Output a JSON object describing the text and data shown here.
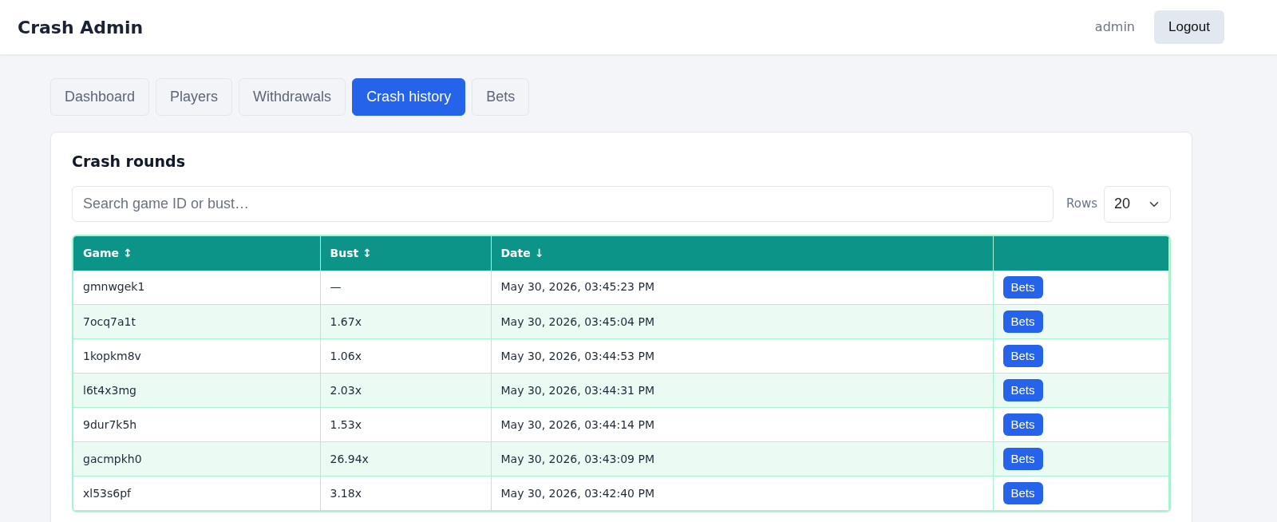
{
  "app": {
    "title": "Crash Admin",
    "user": "admin",
    "logout": "Logout"
  },
  "tabs": [
    {
      "label": "Dashboard",
      "selected": false
    },
    {
      "label": "Players",
      "selected": false
    },
    {
      "label": "Withdrawals",
      "selected": false
    },
    {
      "label": "Crash history",
      "selected": true
    },
    {
      "label": "Bets",
      "selected": false
    }
  ],
  "panel": {
    "title": "Crash rounds",
    "search": {
      "placeholder": "Search game ID or bust…"
    },
    "rows_label": "Rows",
    "rows_value": "20"
  },
  "table": {
    "columns": [
      "Game ↕",
      "Bust ↕",
      "Date ↓"
    ],
    "rows": [
      {
        "game": "gmnwgek1",
        "bust": "—",
        "date": "May 30, 2026, 03:45:23 PM",
        "action": "Bets"
      },
      {
        "game": "7ocq7a1t",
        "bust": "1.67x",
        "date": "May 30, 2026, 03:45:04 PM",
        "action": "Bets"
      },
      {
        "game": "1kopkm8v",
        "bust": "1.06x",
        "date": "May 30, 2026, 03:44:53 PM",
        "action": "Bets"
      },
      {
        "game": "l6t4x3mg",
        "bust": "2.03x",
        "date": "May 30, 2026, 03:44:31 PM",
        "action": "Bets"
      },
      {
        "game": "9dur7k5h",
        "bust": "1.53x",
        "date": "May 30, 2026, 03:44:14 PM",
        "action": "Bets"
      },
      {
        "game": "gacmpkh0",
        "bust": "26.94x",
        "date": "May 30, 2026, 03:43:09 PM",
        "action": "Bets"
      },
      {
        "game": "xl53s6pf",
        "bust": "3.18x",
        "date": "May 30, 2026, 03:42:40 PM",
        "action": "Bets"
      }
    ]
  }
}
